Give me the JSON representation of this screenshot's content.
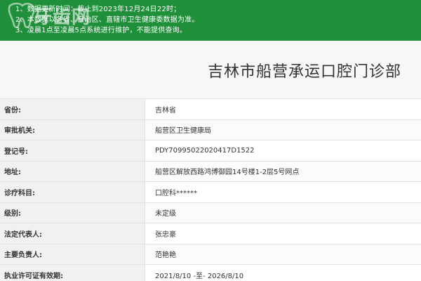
{
  "notice": {
    "lines": [
      "1、数据更新时间：截止到2023年12月24日22时；",
      "2、本数据以各省、自治区、直辖市卫生健康委数据为准。",
      "3、凌晨1点至凌晨5点系统进行维护，不能提供查询。"
    ],
    "logo_text": "牙齿网",
    "background_color": "#1f8f3a"
  },
  "title": "吉林市船营承运口腔门诊部",
  "info_rows": [
    {
      "label": "省份:",
      "value": "吉林省"
    },
    {
      "label": "审批机关:",
      "value": "船营区卫生健康局"
    },
    {
      "label": "登记号:",
      "value": "PDY70995022020417D1522"
    },
    {
      "label": "地址:",
      "value": "船营区解放西路鸿博御园14号楼1-2层5号网点"
    },
    {
      "label": "诊疗科目:",
      "value": "口腔科******"
    },
    {
      "label": "级别:",
      "value": "未定级"
    },
    {
      "label": "法定代表人:",
      "value": "张忠豪"
    },
    {
      "label": "主要负责人:",
      "value": "范艳艳"
    },
    {
      "label": "执业许可证有效期:",
      "value": "2021/8/10 -至- 2026/8/10"
    }
  ]
}
